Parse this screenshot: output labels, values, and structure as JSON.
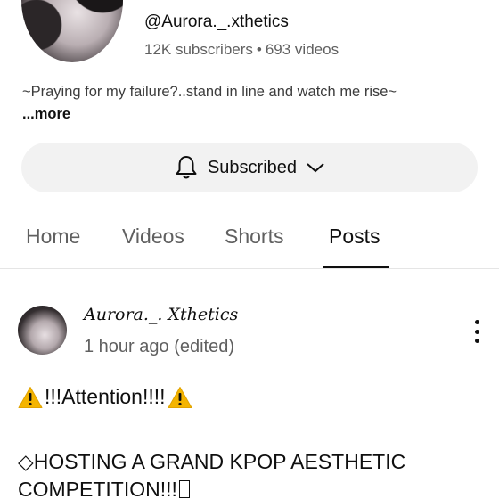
{
  "channel": {
    "handle": "@Aurora._.xthetics",
    "subscribers": "12K subscribers",
    "separator": "•",
    "videos": "693 videos",
    "description": "~Praying for my failure?..stand in line and watch me rise~",
    "more_label": "...more"
  },
  "subscribe": {
    "label": "Subscribed"
  },
  "tabs": [
    {
      "label": "Home"
    },
    {
      "label": "Videos"
    },
    {
      "label": "Shorts"
    },
    {
      "label": "Posts",
      "active": true
    }
  ],
  "post": {
    "author": "Aurora._. Xthetics",
    "time": "1 hour ago (edited)",
    "attention": "!!!Attention!!!!",
    "line_symbol": "◇",
    "line_text": "HOSTING A GRAND KPOP AESTHETIC COMPETITION!!!"
  },
  "colors": {
    "warning": "#f4b400",
    "accent_text": "#0f0f0f",
    "muted": "#606060"
  }
}
